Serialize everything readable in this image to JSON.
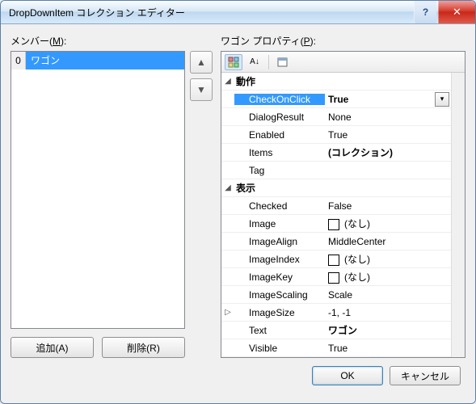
{
  "title": "DropDownItem コレクション エディター",
  "members": {
    "label": "メンバー(",
    "accel": "M",
    "label_end": "):"
  },
  "list": {
    "items": [
      {
        "index": "0",
        "text": "ワゴン"
      }
    ]
  },
  "add_btn": "追加(A)",
  "remove_btn": "削除(R)",
  "props_label_pre": "ワゴン プロパティ(",
  "props_accel": "P",
  "props_label_post": "):",
  "categories": [
    {
      "expand": "◢",
      "name": "動作",
      "props": [
        {
          "name": "CheckOnClick",
          "value": "True",
          "bold": true,
          "selected": true,
          "dropdown": true
        },
        {
          "name": "DialogResult",
          "value": "None"
        },
        {
          "name": "Enabled",
          "value": "True"
        },
        {
          "name": "Items",
          "value": "(コレクション)",
          "bold": true
        },
        {
          "name": "Tag",
          "value": ""
        }
      ]
    },
    {
      "expand": "◢",
      "name": "表示",
      "props": [
        {
          "name": "Checked",
          "value": "False"
        },
        {
          "name": "Image",
          "value": "(なし)",
          "swatch": true
        },
        {
          "name": "ImageAlign",
          "value": "MiddleCenter"
        },
        {
          "name": "ImageIndex",
          "value": "(なし)",
          "swatch": true
        },
        {
          "name": "ImageKey",
          "value": "(なし)",
          "swatch": true
        },
        {
          "name": "ImageScaling",
          "value": "Scale"
        },
        {
          "name": "ImageSize",
          "value": "-1, -1",
          "expander": "▷"
        },
        {
          "name": "Text",
          "value": "ワゴン",
          "bold": true
        },
        {
          "name": "Visible",
          "value": "True"
        }
      ]
    }
  ],
  "ok": "OK",
  "cancel": "キャンセル"
}
